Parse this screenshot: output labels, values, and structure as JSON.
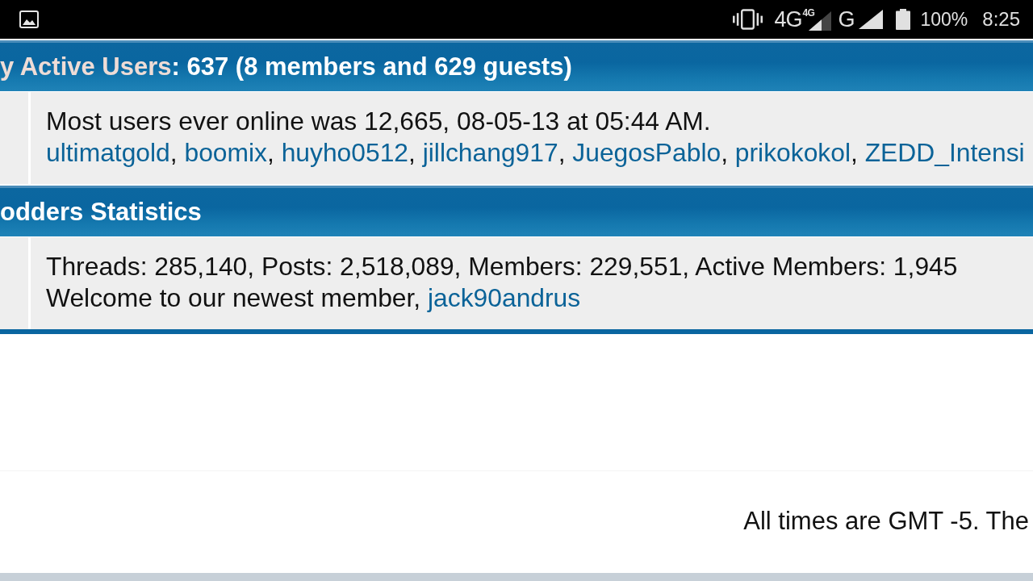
{
  "status_bar": {
    "sim_1": {
      "network": "4G",
      "signal_badge": "4G"
    },
    "sim_2": {
      "network": "G"
    },
    "battery": "100%",
    "time": "8:25"
  },
  "sections": [
    {
      "title": [
        {
          "kind": "link",
          "text": "y Active Users"
        },
        {
          "kind": "text",
          "text": ": 637 (8 members and 629 guests)"
        }
      ],
      "lines": [
        [
          {
            "kind": "text",
            "text": "Most users ever online was 12,665, 08-05-13 at 05:44 AM."
          }
        ],
        [
          {
            "kind": "link",
            "text": "ultimatgold"
          },
          {
            "kind": "text",
            "text": ", "
          },
          {
            "kind": "link",
            "text": "boomix"
          },
          {
            "kind": "text",
            "text": ", "
          },
          {
            "kind": "link",
            "text": "huyho0512"
          },
          {
            "kind": "text",
            "text": ", "
          },
          {
            "kind": "link",
            "text": "jillchang917"
          },
          {
            "kind": "text",
            "text": ", "
          },
          {
            "kind": "link",
            "text": "JuegosPablo"
          },
          {
            "kind": "text",
            "text": ", "
          },
          {
            "kind": "link",
            "text": "prikokokol"
          },
          {
            "kind": "text",
            "text": ", "
          },
          {
            "kind": "link",
            "text": "ZEDD_Intensi"
          }
        ]
      ]
    },
    {
      "title": [
        {
          "kind": "text",
          "text": "odders Statistics"
        }
      ],
      "lines": [
        [
          {
            "kind": "text",
            "text": "Threads: 285,140, Posts: 2,518,089, Members: 229,551, Active Members: 1,945"
          }
        ],
        [
          {
            "kind": "text",
            "text": "Welcome to our newest member, "
          },
          {
            "kind": "link",
            "text": "jack90andrus"
          }
        ]
      ]
    }
  ],
  "footer": {
    "timezone_note": "All times are GMT -5. The"
  }
}
